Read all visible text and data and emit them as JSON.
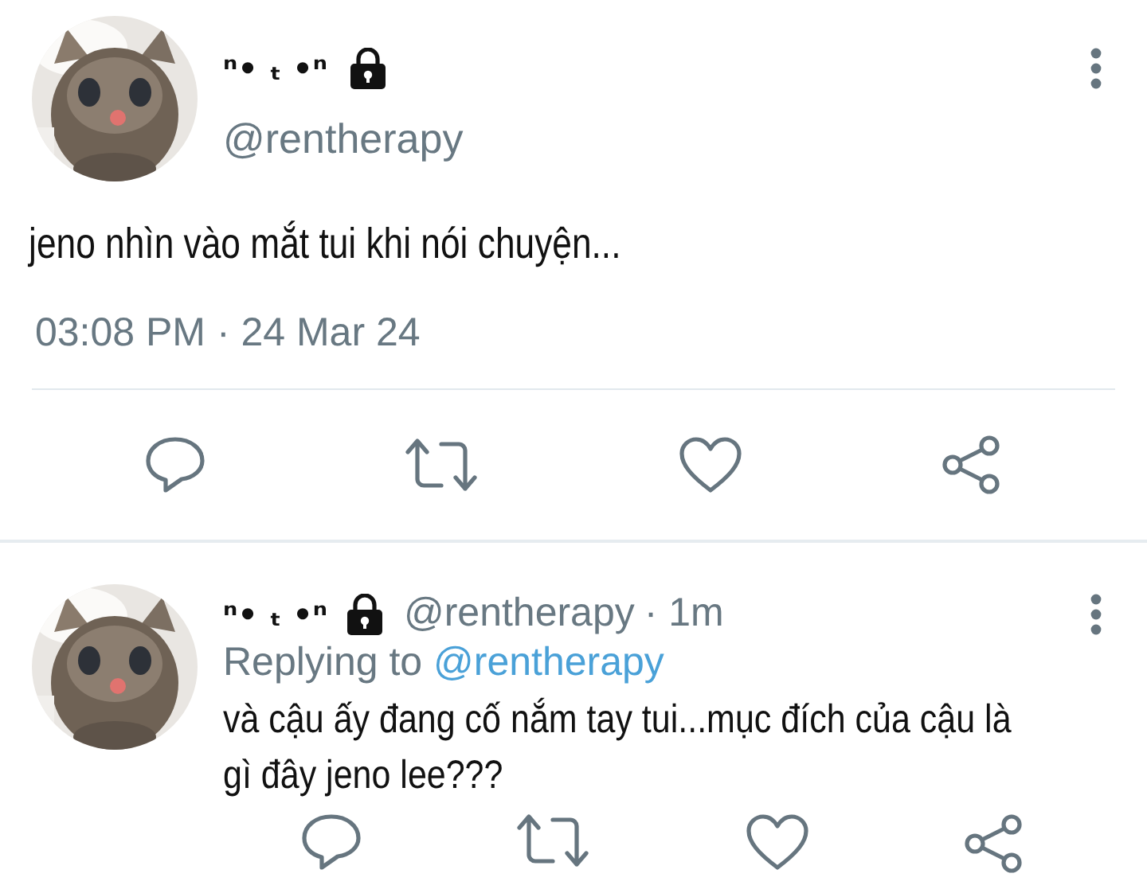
{
  "tweet": {
    "display_name": "ⁿ• ₜ •ⁿ",
    "protected": true,
    "handle": "@rentherapy",
    "text": "jeno nhìn vào mắt tui khi nói chuyện...",
    "timestamp": "03:08 PM · 24 Mar 24"
  },
  "reply": {
    "display_name": "ⁿ• ₜ •ⁿ",
    "protected": true,
    "handle": "@rentherapy",
    "time": "· 1m",
    "replying_label": "Replying to",
    "replying_to": "@rentherapy",
    "text": "và cậu ấy đang cố nắm tay tui...mục đích của cậu là gì đây jeno lee???"
  }
}
